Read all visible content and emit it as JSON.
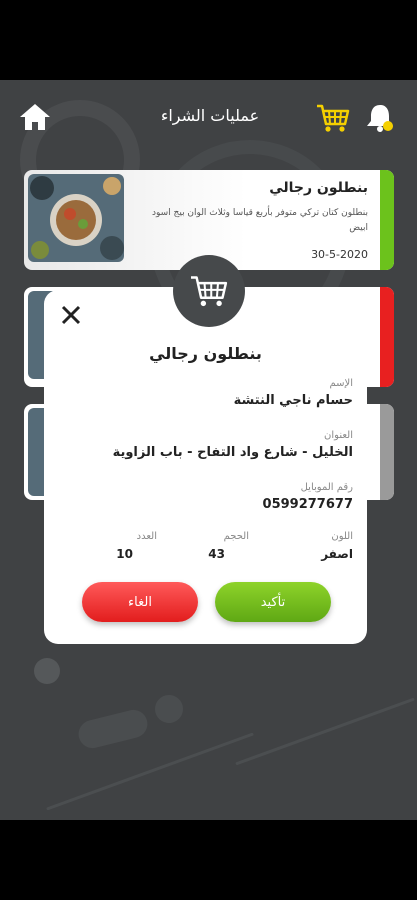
{
  "header": {
    "title": "عمليات الشراء",
    "icons": [
      "home-icon",
      "cart-icon",
      "bell-icon"
    ],
    "accent_color": "#f5d000"
  },
  "orders": [
    {
      "title": "بنطلون رجالي",
      "description": "بنطلون كتان تركي متوفر بأربع قياسا وثلاث الوان بيج اسود ابيض",
      "date": "30-5-2020",
      "status_color": "#6cc21c"
    },
    {
      "status_color": "#e82020"
    },
    {
      "status_color": "#9a9a9a"
    }
  ],
  "modal": {
    "title": "بنطلون رجالي",
    "name_label": "الإسم",
    "name_value": "حسام ناجي النتشة",
    "address_label": "العنوان",
    "address_value": "الخليل - شارع واد التفاح - باب الزاوية",
    "mobile_label": "رقم الموبايل",
    "mobile_value": "0599277677",
    "color_label": "اللون",
    "color_value": "اصفر",
    "size_label": "الحجم",
    "size_value": "43",
    "count_label": "العدد",
    "count_value": "10",
    "confirm_label": "تأكيد",
    "cancel_label": "الغاء"
  }
}
